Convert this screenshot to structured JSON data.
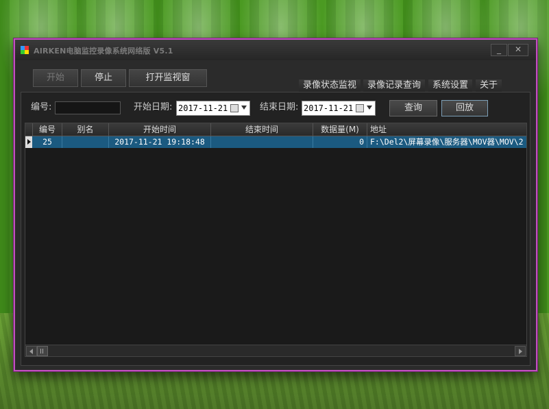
{
  "window": {
    "title": "AIRKEN电脑监控录像系统网络版 V5.1",
    "minimize_glyph": "_",
    "close_glyph": "✕"
  },
  "toolbar": {
    "start_label": "开始",
    "stop_label": "停止",
    "open_monitor_label": "打开监视窗"
  },
  "tabs": [
    {
      "label": "录像状态监视"
    },
    {
      "label": "录像记录查询"
    },
    {
      "label": "系统设置"
    },
    {
      "label": "关于"
    }
  ],
  "query": {
    "id_label": "编号:",
    "id_value": "",
    "start_date_label": "开始日期:",
    "start_date_value": "2017-11-21",
    "end_date_label": "结束日期:",
    "end_date_value": "2017-11-21",
    "search_label": "查询",
    "playback_label": "回放"
  },
  "table": {
    "columns": [
      "编号",
      "别名",
      "开始时间",
      "结束时间",
      "数据量(M)",
      "地址"
    ],
    "rows": [
      {
        "id": "25",
        "alias": "",
        "start": "2017-11-21 19:18:48",
        "end": "",
        "size": "0",
        "path": "F:\\Del2\\屏幕录像\\服务器\\MOV器\\MOV\\2"
      }
    ]
  },
  "colors": {
    "window_border": "#c34fc0",
    "selected_row": "#1b5a80",
    "background_green": "#4b9a22"
  }
}
